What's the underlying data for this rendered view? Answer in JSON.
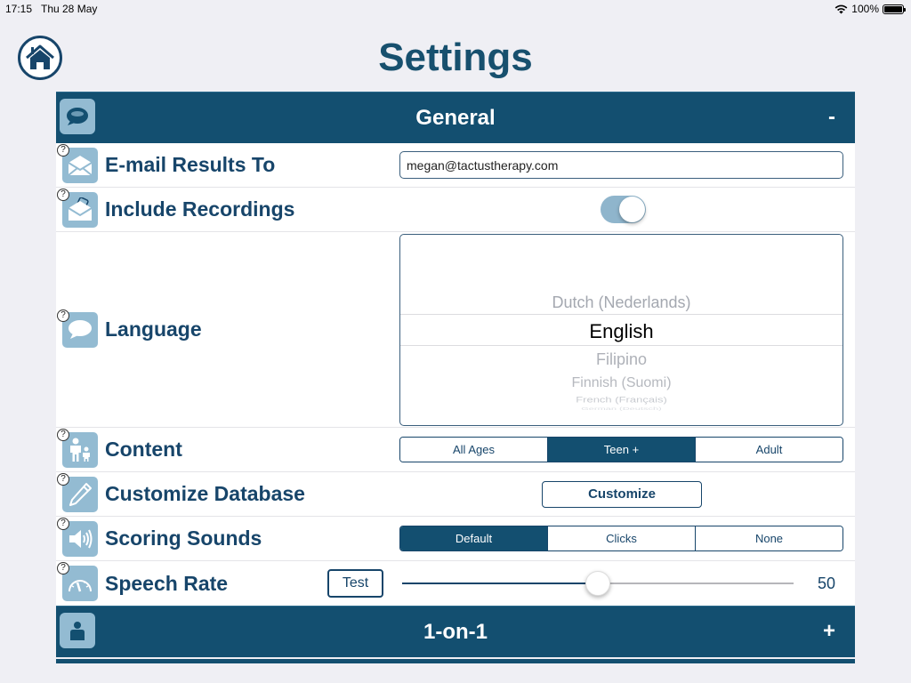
{
  "status_bar": {
    "time": "17:15",
    "date": "Thu 28 May",
    "battery_text": "100%",
    "wifi_icon": "wifi-icon",
    "battery_icon": "battery-icon"
  },
  "header": {
    "title": "Settings",
    "home_icon": "home-icon"
  },
  "sections": {
    "general": {
      "title": "General",
      "toggle": "-",
      "icon": "speech-bubble-icon",
      "expanded": true
    },
    "one_on_one": {
      "title": "1-on-1",
      "toggle": "+",
      "icon": "person-icon",
      "expanded": false
    }
  },
  "help_glyph": "?",
  "rows": {
    "email": {
      "label": "E-mail Results To",
      "icon": "envelope-icon",
      "value": "megan@tactustherapy.com"
    },
    "recordings": {
      "label": "Include Recordings",
      "icon": "envelope-recording-icon",
      "enabled": true
    },
    "language": {
      "label": "Language",
      "icon": "speech-bubble-icon",
      "options": [
        "Dutch (Nederlands)",
        "English",
        "Filipino",
        "Finnish (Suomi)",
        "French (Français)",
        "German (Deutsch)"
      ],
      "selected": "English"
    },
    "content": {
      "label": "Content",
      "icon": "parent-child-icon",
      "options": [
        "All Ages",
        "Teen +",
        "Adult"
      ],
      "selected": "Teen +"
    },
    "customize": {
      "label": "Customize Database",
      "icon": "pencil-icon",
      "button": "Customize"
    },
    "scoring": {
      "label": "Scoring Sounds",
      "icon": "speaker-icon",
      "options": [
        "Default",
        "Clicks",
        "None"
      ],
      "selected": "Default"
    },
    "speech_rate": {
      "label": "Speech Rate",
      "icon": "speedometer-icon",
      "test_button": "Test",
      "value": 50,
      "value_text": "50",
      "min": 0,
      "max": 100
    }
  },
  "colors": {
    "primary": "#134f70",
    "icon_bg": "#93bbd2",
    "text": "#17456a",
    "background": "#efeff4"
  }
}
